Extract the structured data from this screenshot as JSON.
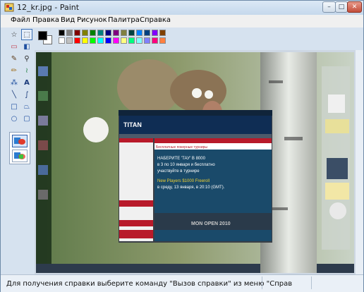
{
  "window": {
    "title": "12_kr.jpg - Paint",
    "controls": {
      "minimize": "–",
      "maximize": "□",
      "close": "✕"
    }
  },
  "menu": {
    "items": [
      "Файл",
      "Правка",
      "Вид",
      "Рисунок",
      "Палитра",
      "Справка"
    ]
  },
  "tools": [
    {
      "name": "free-form-select-icon",
      "glyph": "☆"
    },
    {
      "name": "rect-select-icon",
      "glyph": "⬚"
    },
    {
      "name": "eraser-icon",
      "glyph": "▭"
    },
    {
      "name": "fill-icon",
      "glyph": "◧"
    },
    {
      "name": "color-picker-icon",
      "glyph": "✎"
    },
    {
      "name": "magnifier-icon",
      "glyph": "⚲"
    },
    {
      "name": "pencil-icon",
      "glyph": "✏"
    },
    {
      "name": "brush-icon",
      "glyph": "≀"
    },
    {
      "name": "airbrush-icon",
      "glyph": "⁂"
    },
    {
      "name": "text-icon",
      "glyph": "A"
    },
    {
      "name": "line-icon",
      "glyph": "╲"
    },
    {
      "name": "curve-icon",
      "glyph": "∫"
    },
    {
      "name": "rectangle-icon",
      "glyph": "□"
    },
    {
      "name": "polygon-icon",
      "glyph": "⏢"
    },
    {
      "name": "ellipse-icon",
      "glyph": "○"
    },
    {
      "name": "rounded-rect-icon",
      "glyph": "▢"
    }
  ],
  "palette": {
    "foreground": "#000000",
    "background": "#ffffff",
    "colors": [
      "#000000",
      "#808080",
      "#800000",
      "#808000",
      "#008000",
      "#008080",
      "#000080",
      "#800080",
      "#808040",
      "#004040",
      "#0080ff",
      "#004080",
      "#8000ff",
      "#804000",
      "#ffffff",
      "#c0c0c0",
      "#ff0000",
      "#ffff00",
      "#00ff00",
      "#00ffff",
      "#0000ff",
      "#ff00ff",
      "#ffff80",
      "#00ff80",
      "#80ffff",
      "#8080ff",
      "#ff0080",
      "#ff8040"
    ]
  },
  "screenshot_content": {
    "poker_heading": "Бесплатные покерные турниры",
    "promo_line_1": "НАБЕРИТЕ 'ТАУ' В 8000",
    "promo_line_2": "в 3 по 10 января и бесплатно",
    "promo_line_3": "участвуйте в турнире",
    "promo_big_1": "New Players $1000 Freeroll",
    "promo_big_2": "в среду, 13 января, в 20:10 (GMT).",
    "banner": "MON OPEN 2010",
    "logo": "TITAN"
  },
  "status": {
    "text": "Для получения справки выберите команду \"Вызов справки\" из меню \"Справ"
  }
}
